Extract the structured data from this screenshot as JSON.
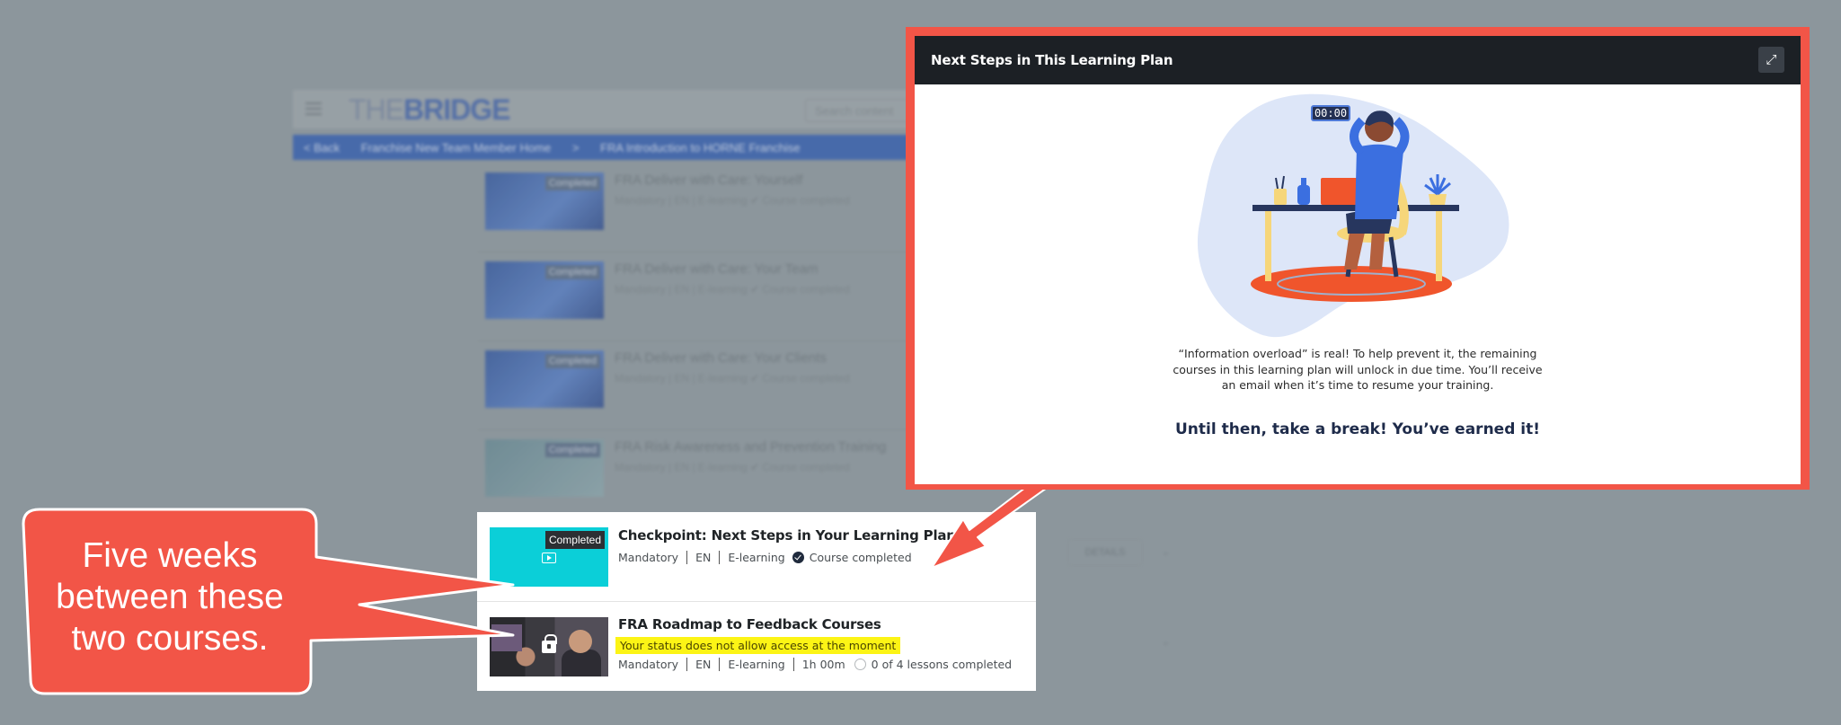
{
  "background": {
    "logo_light": "THE",
    "logo_bold": "BRIDGE",
    "search_placeholder": "Search content",
    "breadcrumb": [
      "< Back",
      "Franchise New Team Member Home",
      ">",
      "FRA Introduction to HORNE Franchise"
    ],
    "details_label": "DETAILS",
    "items": [
      {
        "title": "FRA Deliver with Care: Yourself",
        "meta": "Mandatory | EN | E-learning   ✔ Course completed",
        "badge": "Completed"
      },
      {
        "title": "FRA Deliver with Care: Your Team",
        "meta": "Mandatory | EN | E-learning   ✔ Course completed",
        "badge": "Completed"
      },
      {
        "title": "FRA Deliver with Care: Your Clients",
        "meta": "Mandatory | EN | E-learning   ✔ Course completed",
        "badge": "Completed"
      },
      {
        "title": "FRA Risk Awareness and Prevention Training",
        "meta": "Mandatory | EN | E-learning   ✔ Course completed",
        "badge": "Completed"
      }
    ]
  },
  "courses": [
    {
      "title": "Checkpoint: Next Steps in Your Learning Plan",
      "badge": "Completed",
      "meta": [
        "Mandatory",
        "EN",
        "E-learning"
      ],
      "status": "Course completed"
    },
    {
      "title": "FRA Roadmap to Feedback Courses",
      "warning": "Your status does not allow access at the moment",
      "meta": [
        "Mandatory",
        "EN",
        "E-learning",
        "1h 00m"
      ],
      "status": "0 of 4 lessons completed"
    }
  ],
  "callout": {
    "line1": "Five weeks",
    "line2": "between these",
    "line3": "two courses.",
    "color": "#f25547"
  },
  "modal": {
    "title": "Next Steps in This Learning Plan",
    "timer": "00:00",
    "body": "“Information overload” is real! To help prevent it, the remaining courses in this learning plan will unlock in due time. You’ll receive an email when it’s time to resume your training.",
    "cta": "Until then, take a break! You’ve earned it!",
    "frame_color": "#f25547",
    "header_color": "#1c2025"
  }
}
